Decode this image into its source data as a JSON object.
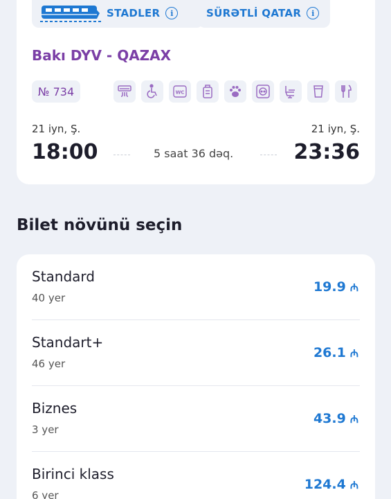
{
  "trip": {
    "train_type": "STADLER",
    "train_class": "SÜRƏTLİ QATAR",
    "route": "Bakı DYV - QAZAX",
    "train_number": "№ 734",
    "amenities": [
      "air-conditioning-icon",
      "wheelchair-icon",
      "wc-icon",
      "luggage-icon",
      "pet-icon",
      "power-socket-icon",
      "seat-icon",
      "drink-icon",
      "restaurant-icon"
    ],
    "departure": {
      "date": "21 iyn, Ş.",
      "time": "18:00"
    },
    "arrival": {
      "date": "21 iyn, Ş.",
      "time": "23:36"
    },
    "duration": "5 saat 36 dəq."
  },
  "tickets_section": {
    "title": "Bilet növünü seçin",
    "currency": "₼",
    "items": [
      {
        "name": "Standard",
        "seats": "40 yer",
        "price": "19.9"
      },
      {
        "name": "Standart+",
        "seats": "46 yer",
        "price": "26.1"
      },
      {
        "name": "Biznes",
        "seats": "3 yer",
        "price": "43.9"
      },
      {
        "name": "Birinci klass",
        "seats": "6 yer",
        "price": "124.4"
      }
    ]
  },
  "colors": {
    "accent_blue": "#1e78d2",
    "route_purple": "#7b3fa6",
    "background": "#eef1f7"
  }
}
